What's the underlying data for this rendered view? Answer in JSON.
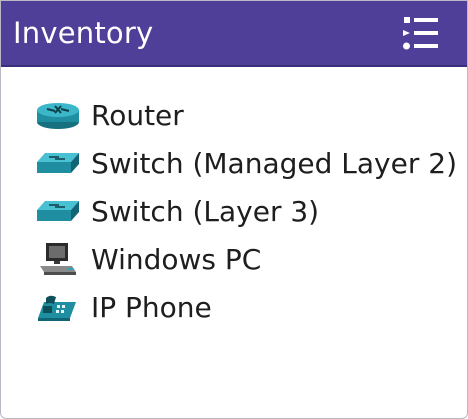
{
  "header": {
    "title": "Inventory",
    "menu_icon": "list-menu-icon"
  },
  "inventory": {
    "items": [
      {
        "label": "Router",
        "icon": "router-icon"
      },
      {
        "label": "Switch (Managed Layer 2)",
        "icon": "switch-icon"
      },
      {
        "label": "Switch (Layer 3)",
        "icon": "switch-icon"
      },
      {
        "label": "Windows PC",
        "icon": "pc-icon"
      },
      {
        "label": "IP Phone",
        "icon": "ip-phone-icon"
      }
    ]
  },
  "colors": {
    "header_bg": "#4f3f98",
    "header_text": "#ffffff",
    "item_text": "#1e1e1e",
    "device_teal": "#2aa3b7"
  }
}
